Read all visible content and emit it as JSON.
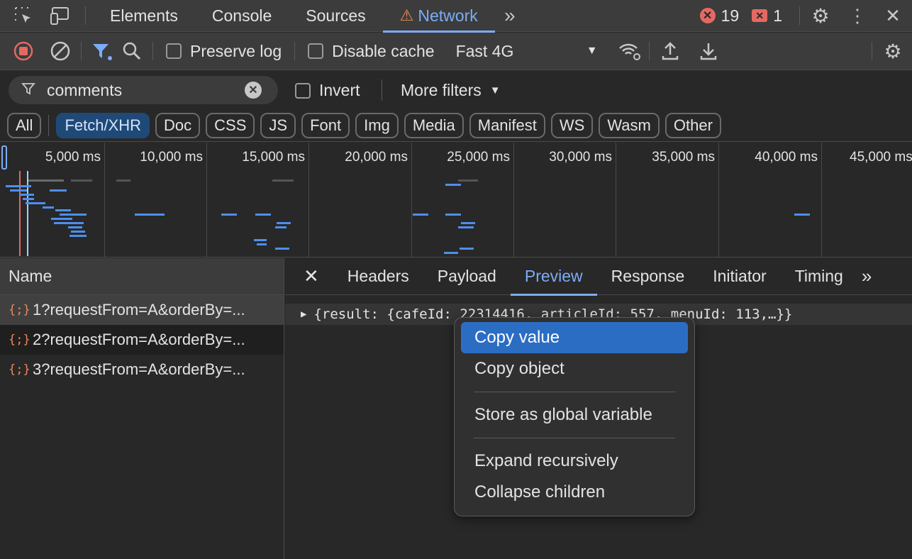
{
  "tabbar": {
    "tabs": [
      {
        "label": "Elements"
      },
      {
        "label": "Console"
      },
      {
        "label": "Sources"
      },
      {
        "label": "Network"
      }
    ],
    "errors": "19",
    "issues": "1"
  },
  "toolbar": {
    "preserve_log": "Preserve log",
    "disable_cache": "Disable cache",
    "throttle": "Fast 4G"
  },
  "filter": {
    "value": "comments",
    "invert": "Invert",
    "more": "More filters"
  },
  "chips": [
    "All",
    "Fetch/XHR",
    "Doc",
    "CSS",
    "JS",
    "Font",
    "Img",
    "Media",
    "Manifest",
    "WS",
    "Wasm",
    "Other"
  ],
  "timeline": {
    "ticks": [
      "5,000 ms",
      "10,000 ms",
      "15,000 ms",
      "20,000 ms",
      "25,000 ms",
      "30,000 ms",
      "35,000 ms",
      "40,000 ms",
      "45,000 ms"
    ]
  },
  "requests": {
    "header": "Name",
    "items": [
      "1?requestFrom=A&orderBy=...",
      "2?requestFrom=A&orderBy=...",
      "3?requestFrom=A&orderBy=..."
    ]
  },
  "details": {
    "tabs": [
      "Headers",
      "Payload",
      "Preview",
      "Response",
      "Initiator",
      "Timing"
    ],
    "preview": "{result: {cafeId: 22314416, articleId: 557, menuId: 113,…}}"
  },
  "context_menu": {
    "items": [
      "Copy value",
      "Copy object",
      "Store as global variable",
      "Expand recursively",
      "Collapse children"
    ]
  },
  "colors": {
    "accent": "#7cacf8",
    "menu_highlight": "#2c6dc4",
    "error": "#e46962"
  }
}
